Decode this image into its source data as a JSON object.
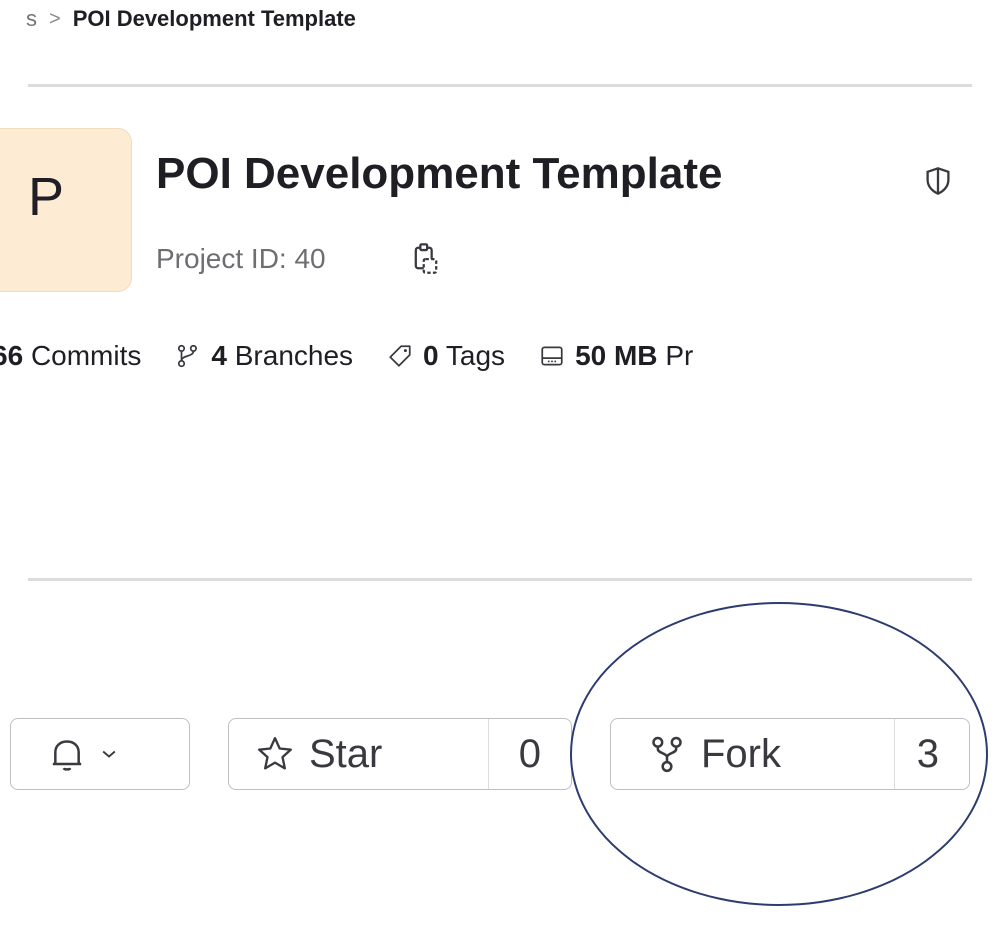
{
  "breadcrumb": {
    "previous": "s",
    "separator": ">",
    "current": "POI Development Template"
  },
  "project": {
    "avatar_letter": "P",
    "title": "POI Development Template",
    "id_text": "Project ID: 40"
  },
  "stats": {
    "commits_count": "66",
    "commits_label": "Commits",
    "branches_count": "4",
    "branches_label": "Branches",
    "tags_count": "0",
    "tags_label": "Tags",
    "storage_value": "50 MB",
    "storage_label": "Pr"
  },
  "actions": {
    "star_label": "Star",
    "star_count": "0",
    "fork_label": "Fork",
    "fork_count": "3"
  },
  "colors": {
    "avatar_bg": "#fdebd4",
    "annotation_circle": "#2d3c6f"
  }
}
